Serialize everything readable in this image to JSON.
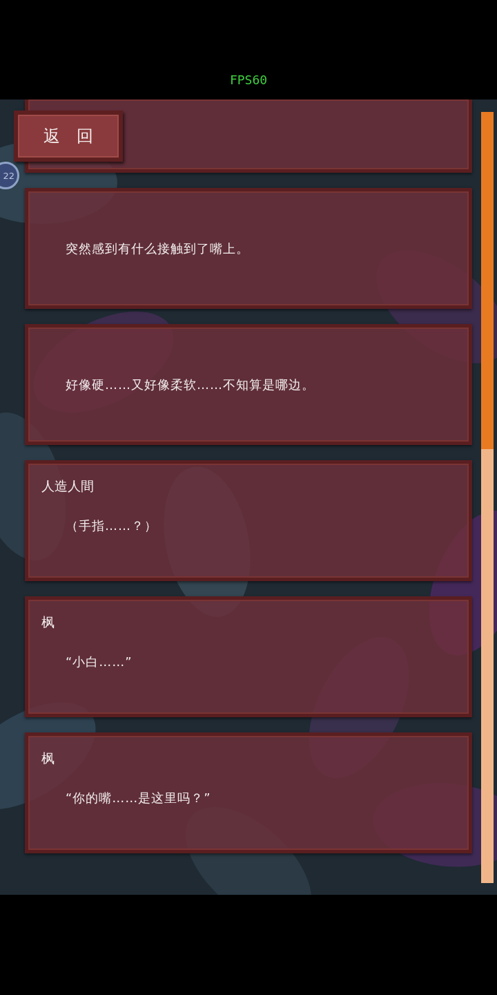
{
  "status_overlay": {
    "fps": "FPS60"
  },
  "back_button": {
    "label": "返　回"
  },
  "side_badge": {
    "text": "22"
  },
  "log": [
    {
      "kind": "partial"
    },
    {
      "kind": "narration",
      "text": "突然感到有什么接触到了嘴上。"
    },
    {
      "kind": "narration",
      "text": "好像硬……又好像柔软……不知算是哪边。"
    },
    {
      "kind": "dialogue",
      "speaker": "人造人間",
      "text": "（手指……？）"
    },
    {
      "kind": "dialogue",
      "speaker": "枫",
      "text": "“小白……”"
    },
    {
      "kind": "dialogue",
      "speaker": "枫",
      "text": "“你的嘴……是这里吗？”"
    }
  ]
}
